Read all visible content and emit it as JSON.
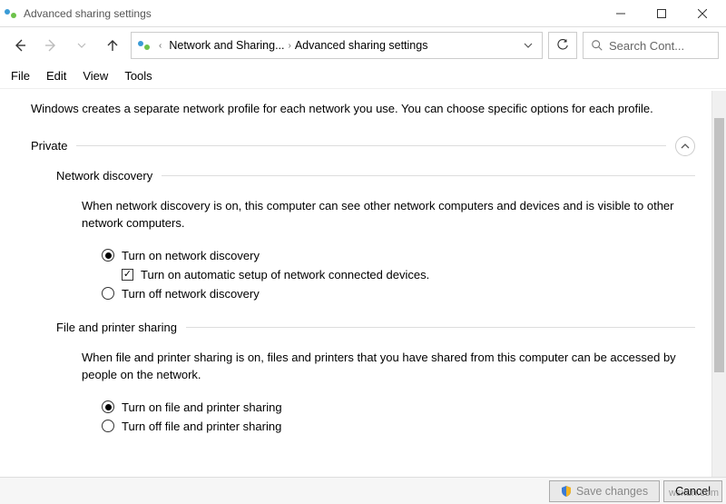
{
  "window": {
    "title": "Advanced sharing settings"
  },
  "breadcrumb": {
    "item1": "Network and Sharing...",
    "item2": "Advanced sharing settings"
  },
  "search": {
    "placeholder": "Search Cont..."
  },
  "menu": {
    "file": "File",
    "edit": "Edit",
    "view": "View",
    "tools": "Tools"
  },
  "main": {
    "intro": "Windows creates a separate network profile for each network you use. You can choose specific options for each profile.",
    "private_section": "Private",
    "network_discovery": {
      "title": "Network discovery",
      "desc": "When network discovery is on, this computer can see other network computers and devices and is visible to other network computers.",
      "radio_on": "Turn on network discovery",
      "checkbox_auto": "Turn on automatic setup of network connected devices.",
      "radio_off": "Turn off network discovery"
    },
    "file_printer": {
      "title": "File and printer sharing",
      "desc": "When file and printer sharing is on, files and printers that you have shared from this computer can be accessed by people on the network.",
      "radio_on": "Turn on file and printer sharing",
      "radio_off": "Turn off file and printer sharing"
    }
  },
  "footer": {
    "save": "Save changes",
    "cancel": "Cancel"
  },
  "watermark": "wsxdn.com"
}
